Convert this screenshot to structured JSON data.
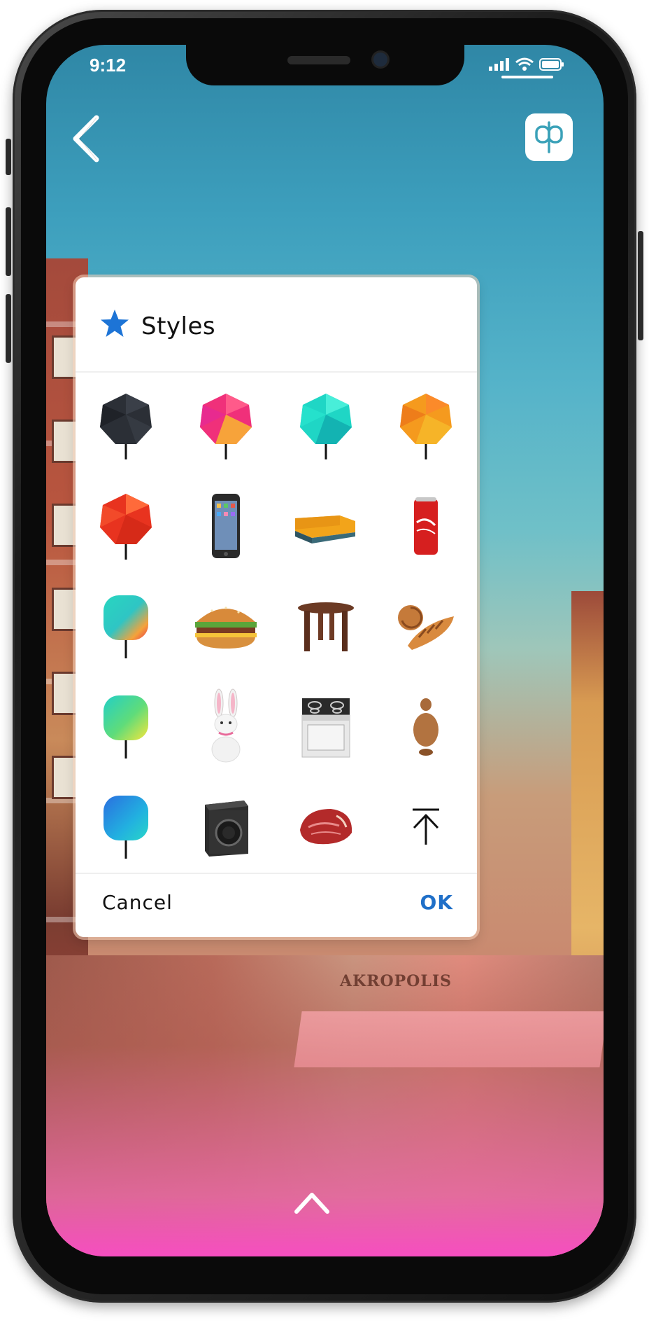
{
  "status_bar": {
    "time": "9:12"
  },
  "header": {
    "back_icon": "chevron-left-icon",
    "ar_icon": "ar-object-icon"
  },
  "background": {
    "shop_sign": "AKROPOLIS"
  },
  "dialog": {
    "title": "Styles",
    "title_icon": "star-icon",
    "accent_color": "#1f6fc8",
    "items": [
      {
        "name": "black-polyhedron-balloon"
      },
      {
        "name": "pink-polyhedron-balloon"
      },
      {
        "name": "teal-polyhedron-balloon"
      },
      {
        "name": "orange-polyhedron-balloon"
      },
      {
        "name": "red-polyhedron-balloon"
      },
      {
        "name": "smartphone"
      },
      {
        "name": "yellow-sofa"
      },
      {
        "name": "soda-can"
      },
      {
        "name": "teal-red-gradient-pin"
      },
      {
        "name": "hamburger"
      },
      {
        "name": "wooden-table"
      },
      {
        "name": "pastries"
      },
      {
        "name": "teal-yellow-gradient-pin"
      },
      {
        "name": "white-rabbit"
      },
      {
        "name": "stove"
      },
      {
        "name": "clay-figurine"
      },
      {
        "name": "blue-gradient-pin"
      },
      {
        "name": "washing-machine"
      },
      {
        "name": "raw-steak"
      },
      {
        "name": "upload-arrow"
      }
    ],
    "cancel_label": "Cancel",
    "ok_label": "OK"
  },
  "footer": {
    "expand_icon": "chevron-up-icon"
  }
}
